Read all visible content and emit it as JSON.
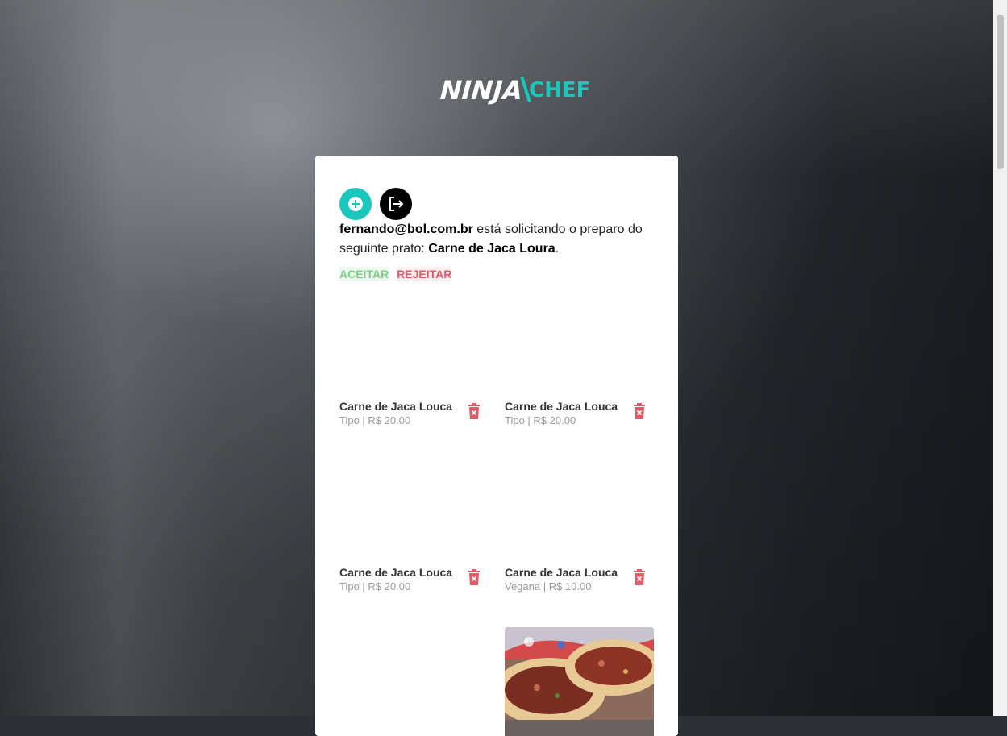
{
  "app": {
    "logo_part1": "NINJA",
    "logo_part2": "CHEF",
    "accent_color": "#19c7bd"
  },
  "toolbar": {
    "add_icon": "plus-circle-icon",
    "logout_icon": "logout-icon"
  },
  "request": {
    "email": "fernando@bol.com.br",
    "text_middle": " está solicitando o preparo do seguinte prato: ",
    "dish": "Carne de Jaca Loura",
    "end": "."
  },
  "actions": {
    "accept": "ACEITAR",
    "reject": "REJEITAR"
  },
  "dishes": [
    {
      "name": "Carne de Jaca Louca",
      "meta": "Tipo | R$ 20.00"
    },
    {
      "name": "Carne de Jaca Louca",
      "meta": "Tipo | R$ 20.00"
    },
    {
      "name": "Carne de Jaca Louca",
      "meta": "Tipo | R$ 20.00"
    },
    {
      "name": "Carne de Jaca Louca",
      "meta": "Vegana | R$ 10.00"
    }
  ]
}
